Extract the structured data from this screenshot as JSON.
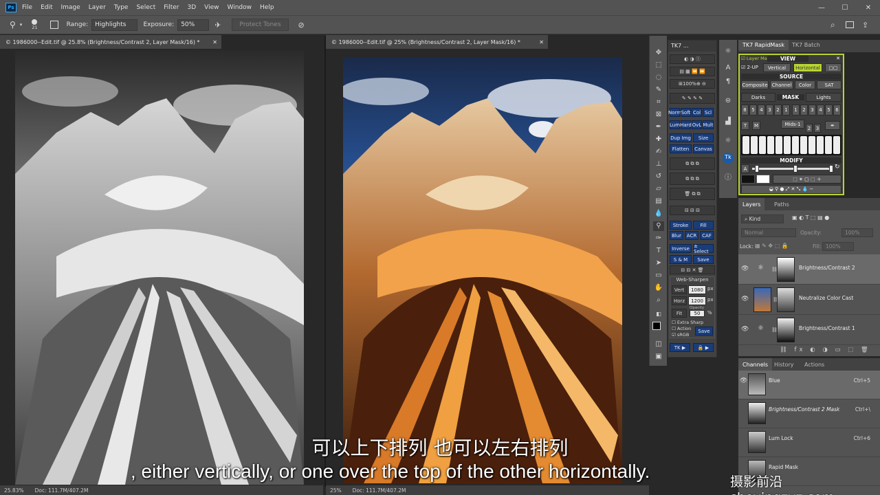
{
  "menubar": {
    "logo": "Ps",
    "items": [
      "File",
      "Edit",
      "Image",
      "Layer",
      "Type",
      "Select",
      "Filter",
      "3D",
      "View",
      "Window",
      "Help"
    ],
    "window_buttons": [
      "—",
      "☐",
      "✕"
    ]
  },
  "options": {
    "brush_size": "21",
    "range_label": "Range:",
    "range_value": "Highlights",
    "exposure_label": "Exposure:",
    "exposure_value": "50%",
    "protect_tones": "Protect Tones"
  },
  "documents": [
    {
      "tab": "© 1986000--Edit.tif @ 25.8% (Brightness/Contrast 2, Layer Mask/16) *",
      "zoom": "25.83%",
      "doc": "Doc: 111.7M/407.2M"
    },
    {
      "tab": "© 1986000--Edit.tif @ 25% (Brightness/Contrast 2, Layer Mask/16) *",
      "zoom": "25%",
      "doc": "Doc: 111.7M/407.2M"
    }
  ],
  "tk7panel": {
    "tab": "TK7 ...",
    "zoom_btn": "100%",
    "row_norm": [
      "Norm",
      "Soft",
      "Col",
      "Scl"
    ],
    "row_lum": [
      "Lum",
      "Hard",
      "OvL",
      "Mult"
    ],
    "row_dup": [
      "Dup Img",
      "Size"
    ],
    "row_flatten": [
      "Flatten",
      "Canvas"
    ],
    "row_stroke": [
      "Stroke",
      "Fill"
    ],
    "row_blur": [
      "Blur",
      "ACR",
      "CAF"
    ],
    "row_inverse": [
      "Inverse",
      "± Select"
    ],
    "row_sm": [
      "S & M",
      "Save"
    ],
    "websharpen": "Web-Sharpen",
    "vert_label": "Vert",
    "vert_value": "1080",
    "horz_label": "Horz",
    "horz_value": "1200",
    "px": "px",
    "fit": "Fit",
    "opacity_label": "Opacity",
    "opacity_value": "50",
    "pct": "%",
    "extra_sharp": "Extra Sharp",
    "action": "Action",
    "srgb": "sRGB",
    "save": "Save",
    "tk_btn": "TK ▶"
  },
  "rapidmask": {
    "tab1": "TK7 RapidMask",
    "tab2": "TK7 Batch",
    "layer_mask": "Layer Mask",
    "view": "VIEW",
    "two_up": "2-UP",
    "vertical": "Vertical",
    "horizontal": "Horizontal",
    "source": "SOURCE",
    "composite": "Composite",
    "channel": "Channel",
    "color": "Color",
    "sat": "SAT",
    "darks": "Darks",
    "mask": "MASK",
    "lights": "Lights",
    "darks_nums": [
      "8",
      "5",
      "4",
      "3",
      "2",
      "1"
    ],
    "lights_nums": [
      "1",
      "2",
      "3",
      "4",
      "5",
      "6"
    ],
    "mids": "Mids-1",
    "mids_nums": [
      "2",
      "3"
    ],
    "modify": "MODIFY",
    "t_btn": "T",
    "m_btn": "M",
    "a_btn": "A"
  },
  "layers": {
    "tabs": [
      "Layers",
      "Paths"
    ],
    "kind": "Kind",
    "blend": "Normal",
    "opacity": "Opacity:",
    "opacity_value": "100%",
    "lock": "Lock:",
    "fill": "Fill:",
    "fill_value": "100%",
    "items": [
      {
        "name": "Brightness/Contrast 2"
      },
      {
        "name": "Neutralize Color Cast"
      },
      {
        "name": "Brightness/Contrast 1"
      }
    ]
  },
  "channels": {
    "tabs": [
      "Channels",
      "History",
      "Actions"
    ],
    "items": [
      {
        "name": "Blue",
        "key": "Ctrl+5"
      },
      {
        "name": "Brightness/Contrast 2 Mask",
        "key": "Ctrl+\\"
      },
      {
        "name": "Lum Lock",
        "key": "Ctrl+6"
      },
      {
        "name": "Rapid Mask",
        "key": ""
      }
    ]
  },
  "subtitles": {
    "chinese": "可以上下排列 也可以左右排列",
    "english": ", either vertically, or one over the top of the other horizontally."
  },
  "watermark": "摄影前沿 sheyingzyz.com",
  "colors": {
    "panel_bg": "#535353",
    "tk_blue": "#1a3d7a",
    "rapid_border": "#b8d432",
    "accent": "#31a8ff"
  }
}
